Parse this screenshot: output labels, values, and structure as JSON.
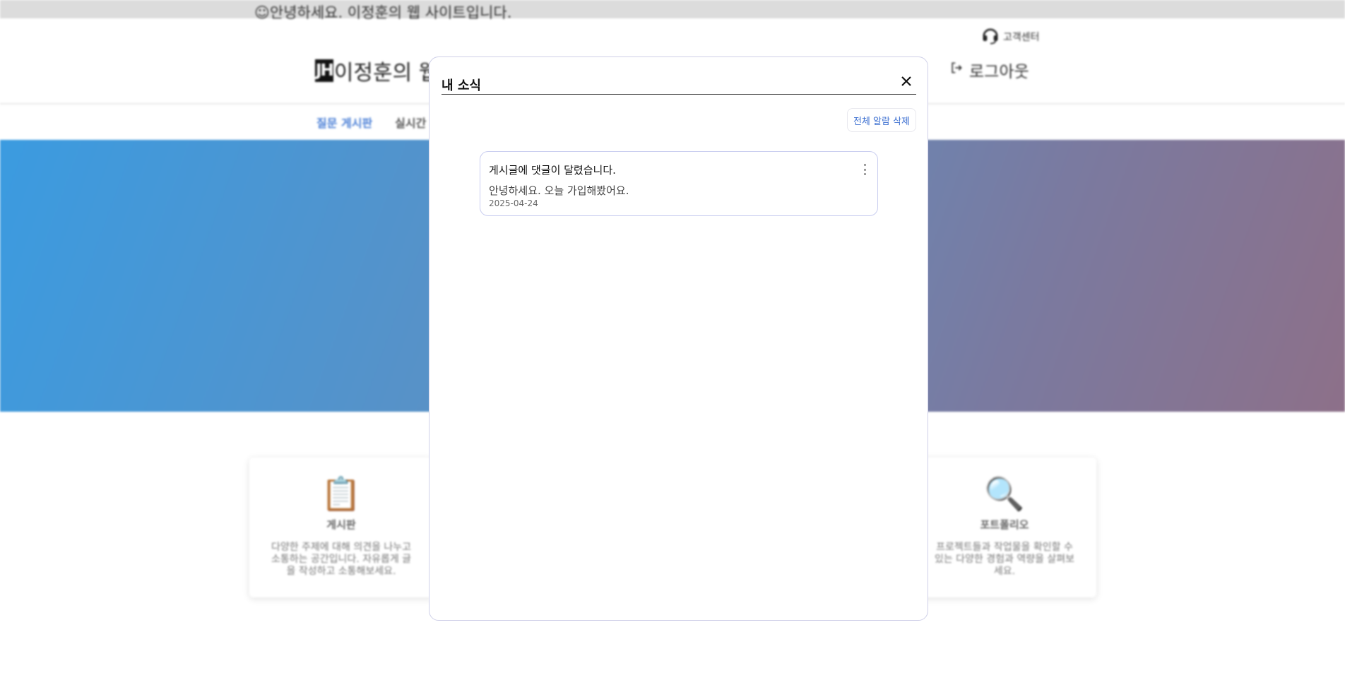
{
  "top_banner": {
    "text": "☺안녕하세요. 이정훈의 웹 사이트입니다."
  },
  "header": {
    "customer_center_label": "고객센터",
    "logo_mark": "JH",
    "logo_text": "이정훈의 웹",
    "logout_label": "로그아웃"
  },
  "nav": {
    "items": [
      {
        "label": "질문 게시판"
      },
      {
        "label": "실시간 채"
      }
    ]
  },
  "cards": [
    {
      "icon": "clipboard-icon",
      "title": "게시판",
      "description": "다양한 주제에 대해 의견을 나누고 소통하는 공간입니다. 자유롭게 글을 작성하고 소통해보세요."
    },
    {
      "icon": "magnifier-icon",
      "title": "포트폴리오",
      "description": "프로젝트들과 작업물을 확인할 수 있는 다양한 경험과 역량을 살펴보세요."
    }
  ],
  "modal": {
    "title": "내 소식",
    "clear_all_label": "전체 알람 삭제",
    "notifications": [
      {
        "title": "게시글에 댓글이 달렸습니다.",
        "message": "안녕하세요. 오늘 가입해봤어요.",
        "date": "2025-04-24"
      }
    ]
  },
  "colors": {
    "accent": "#4a7fd6",
    "hero_start": "#3b9be0",
    "hero_end": "#8d7089",
    "modal_border": "#cfd0e8"
  }
}
